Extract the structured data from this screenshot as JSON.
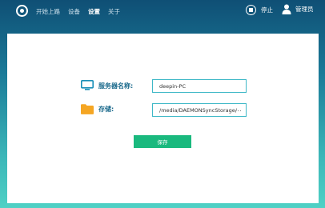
{
  "nav": {
    "items": [
      {
        "label": "开始上路",
        "active": false
      },
      {
        "label": "设备",
        "active": false
      },
      {
        "label": "设置",
        "active": true
      },
      {
        "label": "关于",
        "active": false
      }
    ]
  },
  "header": {
    "stop_label": "停止",
    "user_label": "管理员"
  },
  "form": {
    "server_name_label": "服务器名称:",
    "server_name_value": "deepin-PC",
    "storage_label": "存储:",
    "storage_value": "/media/DAEMONSyncStorage/",
    "browse_label": "...",
    "save_label": "保存"
  },
  "colors": {
    "accent": "#1ab97e",
    "label_blue": "#1b6a8c",
    "field_border": "#3fb8c7",
    "folder": "#f5a623",
    "monitor": "#1a8fb8"
  }
}
